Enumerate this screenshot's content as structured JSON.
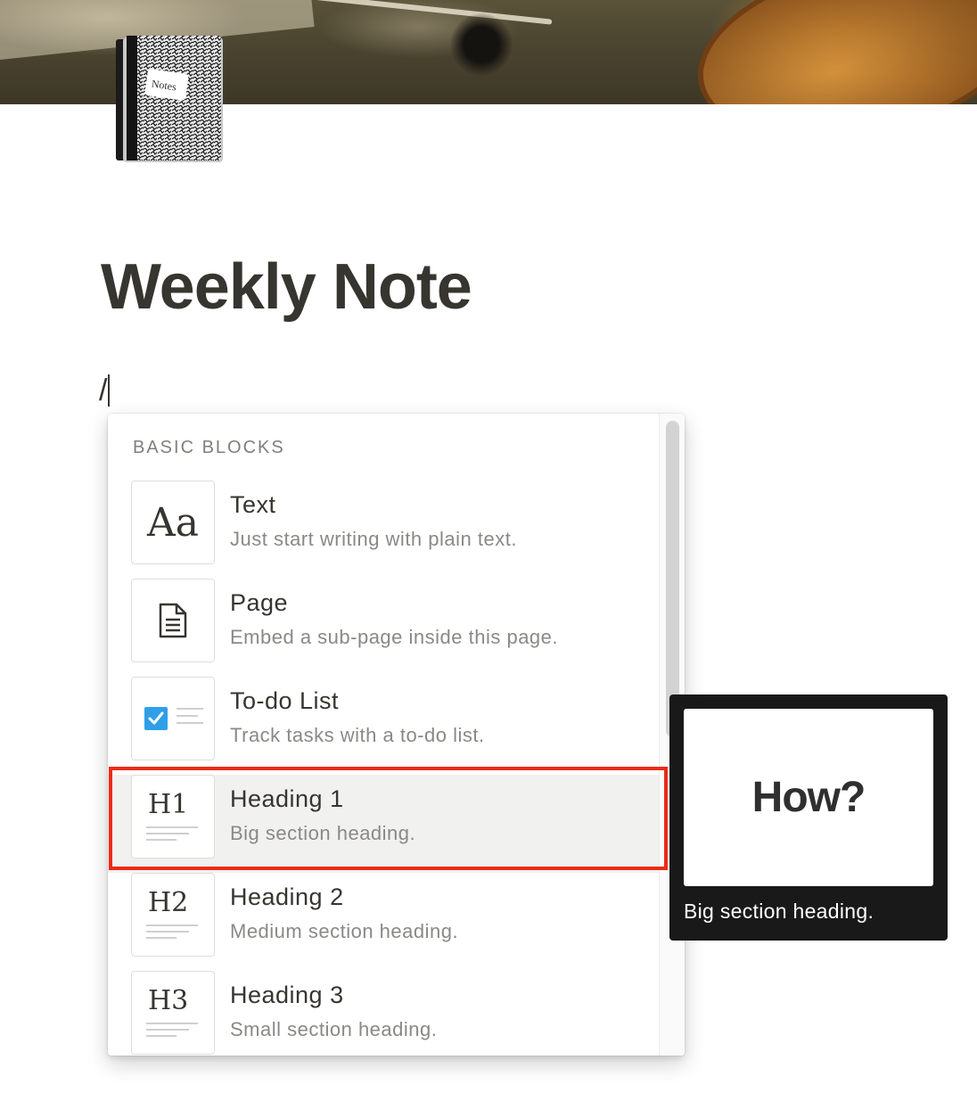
{
  "page": {
    "title": "Weekly Note",
    "input_text": "/",
    "icon": "composition-notebook-icon",
    "icon_label": "Notes"
  },
  "menu": {
    "section_header": "BASIC BLOCKS",
    "items": [
      {
        "name": "Text",
        "description": "Just start writing with plain text.",
        "icon": "Aa"
      },
      {
        "name": "Page",
        "description": "Embed a sub-page inside this page.",
        "icon": "page-icon"
      },
      {
        "name": "To-do List",
        "description": "Track tasks with a to-do list.",
        "icon": "checkbox-icon"
      },
      {
        "name": "Heading 1",
        "description": "Big section heading.",
        "icon": "H1",
        "selected": true
      },
      {
        "name": "Heading 2",
        "description": "Medium section heading.",
        "icon": "H2"
      },
      {
        "name": "Heading 3",
        "description": "Small section heading.",
        "icon": "H3"
      }
    ]
  },
  "preview": {
    "card_text": "How?",
    "caption": "Big section heading."
  },
  "colors": {
    "highlight_border": "#ec2b17",
    "selected_row": "#f1f1f0",
    "checkbox": "#2f9fe8",
    "tooltip_bg": "#191919"
  }
}
